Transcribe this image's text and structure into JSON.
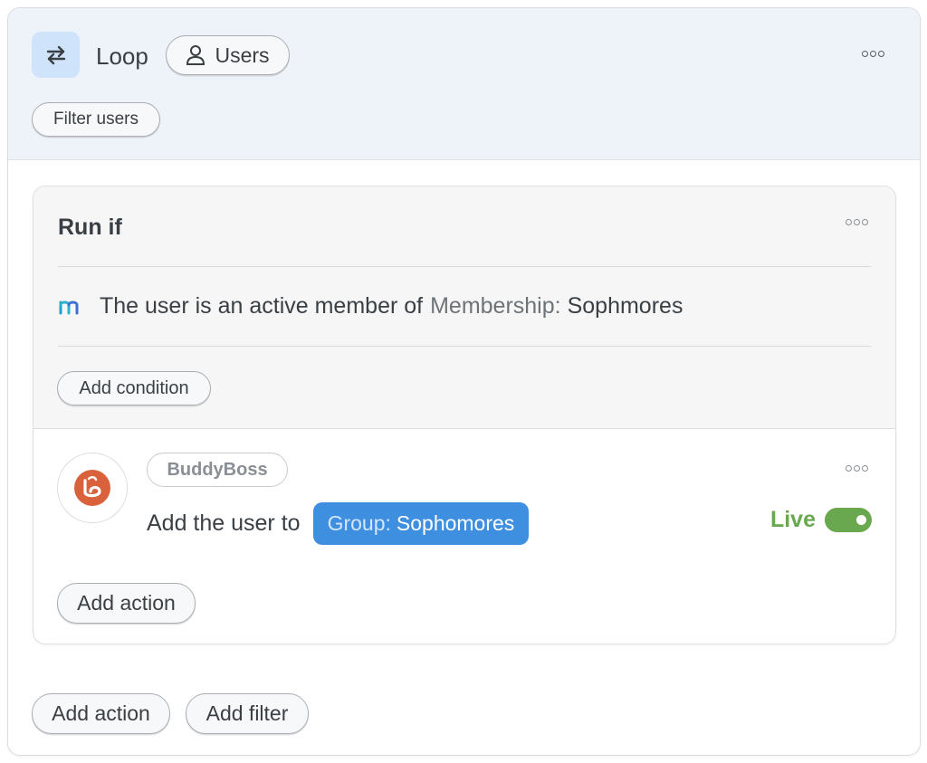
{
  "loop": {
    "title": "Loop",
    "icon": "loop-arrows-icon",
    "users_pill_label": "Users",
    "filter_users_label": "Filter users"
  },
  "run_if": {
    "title": "Run if",
    "condition": {
      "integration_icon": "memberpress-m-icon",
      "text": "The user is an active member of",
      "token_key": "Membership:",
      "token_value": "Sophmores"
    },
    "add_condition_label": "Add condition"
  },
  "action": {
    "integration_badge": "BuddyBoss",
    "text": "Add the user to",
    "token_key": "Group:",
    "token_value": "Sophomores",
    "status_label": "Live",
    "status_on": true,
    "add_action_label": "Add action"
  },
  "footer": {
    "add_action_label": "Add action",
    "add_filter_label": "Add filter"
  },
  "colors": {
    "header_bg": "#eef3fa",
    "loop_icon_bg": "#cfe3fa",
    "token_bg": "#3e8fe0",
    "live_green": "#6aa84f",
    "buddyboss_orange": "#d9623d"
  }
}
